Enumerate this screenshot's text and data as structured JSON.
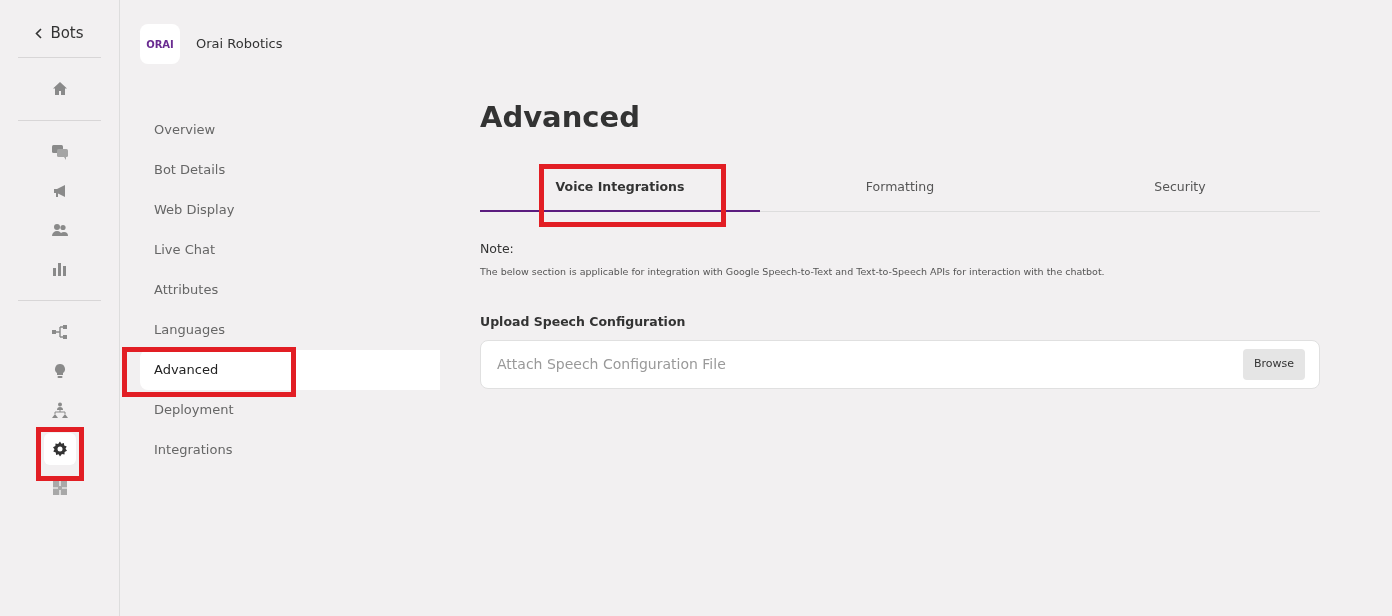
{
  "rail": {
    "back_label": "Bots",
    "groups": [
      [
        {
          "selected": false,
          "highlighted": false
        }
      ],
      [
        {
          "selected": false,
          "highlighted": false
        },
        {
          "selected": false,
          "highlighted": false
        },
        {
          "selected": false,
          "highlighted": false
        },
        {
          "selected": false,
          "highlighted": false
        }
      ],
      [
        {
          "selected": false,
          "highlighted": false
        },
        {
          "selected": false,
          "highlighted": false
        },
        {
          "selected": false,
          "highlighted": false
        },
        {
          "selected": true,
          "highlighted": true
        },
        {
          "selected": false,
          "highlighted": false
        }
      ]
    ]
  },
  "bot": {
    "logo_text": "ORAI",
    "name": "Orai Robotics"
  },
  "menu": [
    {
      "label": "Overview",
      "selected": false,
      "highlighted": false
    },
    {
      "label": "Bot Details",
      "selected": false,
      "highlighted": false
    },
    {
      "label": "Web Display",
      "selected": false,
      "highlighted": false
    },
    {
      "label": "Live Chat",
      "selected": false,
      "highlighted": false
    },
    {
      "label": "Attributes",
      "selected": false,
      "highlighted": false
    },
    {
      "label": "Languages",
      "selected": false,
      "highlighted": false
    },
    {
      "label": "Advanced",
      "selected": true,
      "highlighted": true
    },
    {
      "label": "Deployment",
      "selected": false,
      "highlighted": false
    },
    {
      "label": "Integrations",
      "selected": false,
      "highlighted": false
    }
  ],
  "page_title": "Advanced",
  "tabs": [
    {
      "label": "Voice Integrations",
      "selected": true,
      "highlighted": true
    },
    {
      "label": "Formatting",
      "selected": false,
      "highlighted": false
    },
    {
      "label": "Security",
      "selected": false,
      "highlighted": false
    }
  ],
  "note": {
    "heading": "Note:",
    "text": "The below section is applicable for integration with Google Speech-to-Text and Text-to-Speech APIs for interaction with the chatbot."
  },
  "upload": {
    "label": "Upload Speech Configuration",
    "placeholder": "Attach Speech Configuration File",
    "button": "Browse"
  }
}
